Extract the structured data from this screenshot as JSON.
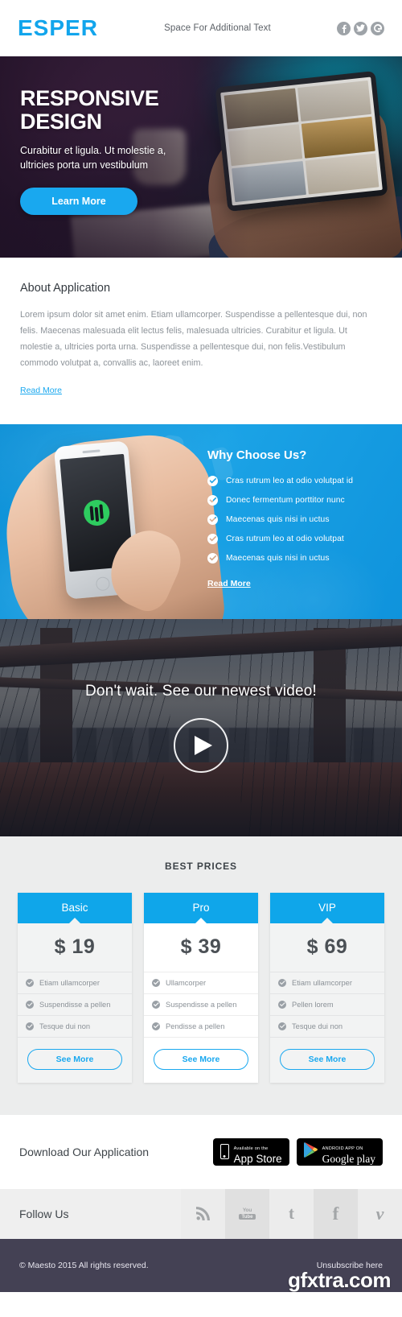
{
  "header": {
    "logo": "ESPER",
    "tagline": "Space For Additional Text",
    "social": [
      {
        "name": "facebook-icon",
        "label": "f"
      },
      {
        "name": "twitter-icon",
        "label": "t"
      },
      {
        "name": "google-icon",
        "label": "G"
      }
    ]
  },
  "hero": {
    "title_line1": "RESPONSIVE",
    "title_line2": "DESIGN",
    "subtitle_line1": "Curabitur et ligula. Ut molestie a,",
    "subtitle_line2": "ultricies porta urn vestibulum",
    "button": "Learn More"
  },
  "about": {
    "title": "About Application",
    "body": "Lorem ipsum dolor sit amet enim. Etiam ullamcorper. Suspendisse a pellentesque dui, non felis. Maecenas malesuada elit lectus felis, malesuada ultricies. Curabitur et ligula. Ut molestie a, ultricies porta urna. Suspendisse a pellentesque dui, non felis.Vestibulum commodo volutpat a, convallis ac, laoreet enim.",
    "read_more": "Read More"
  },
  "why": {
    "title": "Why Choose Us?",
    "items": [
      "Cras rutrum leo at odio volutpat id",
      "Donec fermentum porttitor nunc",
      "Maecenas quis nisi in uctus",
      "Cras rutrum leo at odio volutpat",
      "Maecenas quis nisi in uctus"
    ],
    "read_more": "Read More"
  },
  "video": {
    "title": "Don't wait. See our newest video!",
    "play_label": "play-button"
  },
  "pricing": {
    "title": "BEST PRICES",
    "cards": [
      {
        "plan": "Basic",
        "price": "$ 19",
        "features": [
          "Etiam ullamcorper",
          "Suspendisse a pellen",
          "Tesque dui non"
        ],
        "button": "See More"
      },
      {
        "plan": "Pro",
        "price": "$ 39",
        "features": [
          "Ullamcorper",
          "Suspendisse a pellen",
          "Pendisse a pellen"
        ],
        "button": "See More"
      },
      {
        "plan": "VIP",
        "price": "$ 69",
        "features": [
          "Etiam ullamcorper",
          "Pellen lorem",
          "Tesque dui non"
        ],
        "button": "See More"
      }
    ]
  },
  "download": {
    "title": "Download Our Application",
    "appstore_top": "Available on the",
    "appstore_big": "App Store",
    "gplay_top": "ANDROID APP ON",
    "gplay_big": "Google play"
  },
  "follow": {
    "label": "Follow Us",
    "icons": [
      "rss-icon",
      "youtube-icon",
      "twitter-icon",
      "facebook-icon",
      "vimeo-icon"
    ],
    "youtube_you": "You",
    "youtube_tube": "Tube",
    "twitter_glyph": "t",
    "facebook_glyph": "f",
    "vimeo_glyph": "v"
  },
  "footer": {
    "copyright": "© Maesto 2015 All rights reserved.",
    "unsubscribe": "Unsubscribe here",
    "watermark": "gfxtra.com"
  },
  "colors": {
    "brand_blue": "#0fa6ea",
    "link_blue": "#19a8ef",
    "footer_purple": "#444154",
    "pricing_bg": "#eceded"
  }
}
